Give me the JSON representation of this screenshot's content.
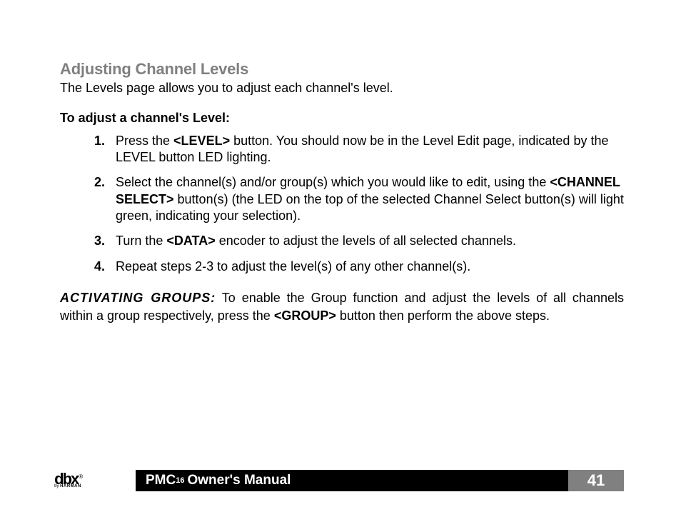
{
  "section": {
    "title": "Adjusting Channel Levels",
    "intro": "The Levels page allows you to adjust each channel's level.",
    "subhead": "To adjust a channel's Level:",
    "steps": [
      {
        "pre": "Press the ",
        "strong": "<LEVEL>",
        "post": " button. You should now be in the Level Edit page, indicated by the LEVEL button LED lighting."
      },
      {
        "pre": "Select the channel(s) and/or group(s) which you would like to edit, using the ",
        "strong": "<CHANNEL SELECT>",
        "post": " button(s) (the LED on the top of the selected Channel Select button(s) will light green, indicating your selection)."
      },
      {
        "pre": "Turn the ",
        "strong": "<DATA>",
        "post": " encoder to adjust the levels of all selected channels."
      },
      {
        "pre": "",
        "strong": "",
        "post": "Repeat steps 2-3 to adjust the level(s) of any other channel(s)."
      }
    ],
    "note": {
      "label": "ACTIVATING GROUPS:",
      "pre": " To enable the Group function and adjust the levels of all channels within a group respectively, press the ",
      "strong": "<GROUP>",
      "post": " button then perform the above steps."
    }
  },
  "footer": {
    "logo": "dbx",
    "logo_reg": "®",
    "logo_sub_by": "by ",
    "logo_sub_brand": "HARMAN",
    "product": "PMC",
    "product_sup": "16",
    "manual": " Owner's Manual",
    "page": "41"
  }
}
